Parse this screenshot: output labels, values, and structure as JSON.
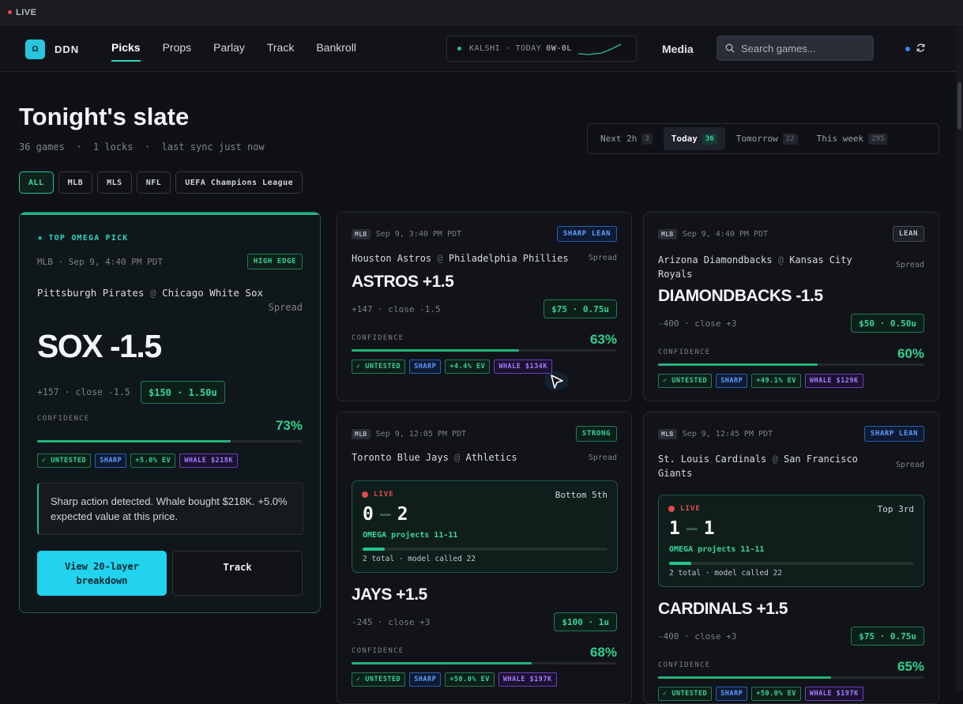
{
  "livebar": {
    "label": "LIVE"
  },
  "nav": {
    "logo_mark": "Ω",
    "brand": "DDN",
    "links": [
      {
        "label": "Picks",
        "active": true
      },
      {
        "label": "Props",
        "active": false
      },
      {
        "label": "Parlay",
        "active": false
      },
      {
        "label": "Track",
        "active": false
      },
      {
        "label": "Bankroll",
        "active": false
      }
    ],
    "ticker": {
      "label": "KALSHI · TODAY",
      "record": "0W-0L"
    },
    "media": "Media",
    "search_placeholder": "Search games...",
    "icons": [
      "search-icon",
      "refresh-icon"
    ]
  },
  "header": {
    "title": "Tonight's slate",
    "subtitle": "36 games  ·  1 locks  ·  last sync just now"
  },
  "range": [
    {
      "label": "Next 2h",
      "count": "3",
      "active": false
    },
    {
      "label": "Today",
      "count": "36",
      "active": true
    },
    {
      "label": "Tomorrow",
      "count": "22",
      "active": false
    },
    {
      "label": "This week",
      "count": "295",
      "active": false
    }
  ],
  "filters": [
    {
      "label": "ALL",
      "active": true
    },
    {
      "label": "MLB",
      "active": false
    },
    {
      "label": "MLS",
      "active": false
    },
    {
      "label": "NFL",
      "active": false
    },
    {
      "label": "UEFA Champions League",
      "active": false
    }
  ],
  "hero": {
    "heading": "TOP OMEGA PICK",
    "meta": "MLB · Sep 9, 4:40 PM PDT",
    "badge": "HIGH EDGE",
    "away": "Pittsburgh Pirates",
    "at": "@",
    "home": "Chicago White Sox",
    "market": "Spread",
    "pick": "SOX -1.5",
    "odds": "+157 · close -1.5",
    "stake": "$150 · 1.50u",
    "conf_label": "CONFIDENCE",
    "confidence": "73%",
    "confidence_value": 73,
    "tags": [
      "✓ UNTESTED",
      "SHARP",
      "+5.0% EV",
      "WHALE $218K"
    ],
    "note": "Sharp action detected. Whale bought $218K. +5.0% expected value at this price.",
    "primary_btn": "View 20-layer breakdown",
    "secondary_btn": "Track"
  },
  "cards": [
    {
      "league": "MLB",
      "meta": "Sep 9, 3:40 PM PDT",
      "badge": "SHARP LEAN",
      "away": "Houston Astros",
      "at": "@",
      "home": "Philadelphia Phillies",
      "market": "Spread",
      "pick": "ASTROS +1.5",
      "odds": "+147 · close -1.5",
      "stake": "$75 · 0.75u",
      "conf_label": "CONFIDENCE",
      "confidence": "63%",
      "confidence_value": 63,
      "tags": [
        "✓ UNTESTED",
        "SHARP",
        "+4.4% EV",
        "WHALE $134K"
      ]
    },
    {
      "league": "MLB",
      "meta": "Sep 9, 4:40 PM PDT",
      "badge": "LEAN",
      "away": "Arizona Diamondbacks",
      "at": "@",
      "home": "Kansas City Royals",
      "market": "Spread",
      "pick": "DIAMONDBACKS -1.5",
      "odds": "-400 · close +3",
      "stake": "$50 · 0.50u",
      "conf_label": "CONFIDENCE",
      "confidence": "60%",
      "confidence_value": 60,
      "tags": [
        "✓ UNTESTED",
        "SHARP",
        "+49.1% EV",
        "WHALE $129K"
      ]
    },
    {
      "league": "MLB",
      "meta": "Sep 9, 12:05 PM PDT",
      "badge": "STRONG",
      "away": "Toronto Blue Jays",
      "at": "@",
      "home": "Athletics",
      "market": "Spread",
      "live": {
        "label": "LIVE",
        "period": "Bottom 5th",
        "away_score": "0",
        "home_score": "2",
        "projection": "OMEGA projects 11-11",
        "total": "2 total · model called 22"
      },
      "pick": "JAYS +1.5",
      "odds": "-245 · close +3",
      "stake": "$100 · 1u",
      "conf_label": "CONFIDENCE",
      "confidence": "68%",
      "confidence_value": 68,
      "tags": [
        "✓ UNTESTED",
        "SHARP",
        "+50.0% EV",
        "WHALE $197K"
      ]
    },
    {
      "league": "MLB",
      "meta": "Sep 9, 12:45 PM PDT",
      "badge": "SHARP LEAN",
      "away": "St. Louis Cardinals",
      "at": "@",
      "home": "San Francisco Giants",
      "market": "Spread",
      "live": {
        "label": "LIVE",
        "period": "Top 3rd",
        "away_score": "1",
        "home_score": "1",
        "projection": "OMEGA projects 11-11",
        "total": "2 total · model called 22"
      },
      "pick": "CARDINALS +1.5",
      "odds": "-400 · close +3",
      "stake": "$75 · 0.75u",
      "conf_label": "CONFIDENCE",
      "confidence": "65%",
      "confidence_value": 65,
      "tags": [
        "✓ UNTESTED",
        "SHARP",
        "+50.0% EV",
        "WHALE $197K"
      ]
    }
  ],
  "colors": {
    "accent": "#2dd4bf",
    "positive": "#30d08e",
    "sharp": "#5b9cff",
    "whale": "#a57bff",
    "live": "#e5484d",
    "primary_button": "#22d3ee"
  }
}
